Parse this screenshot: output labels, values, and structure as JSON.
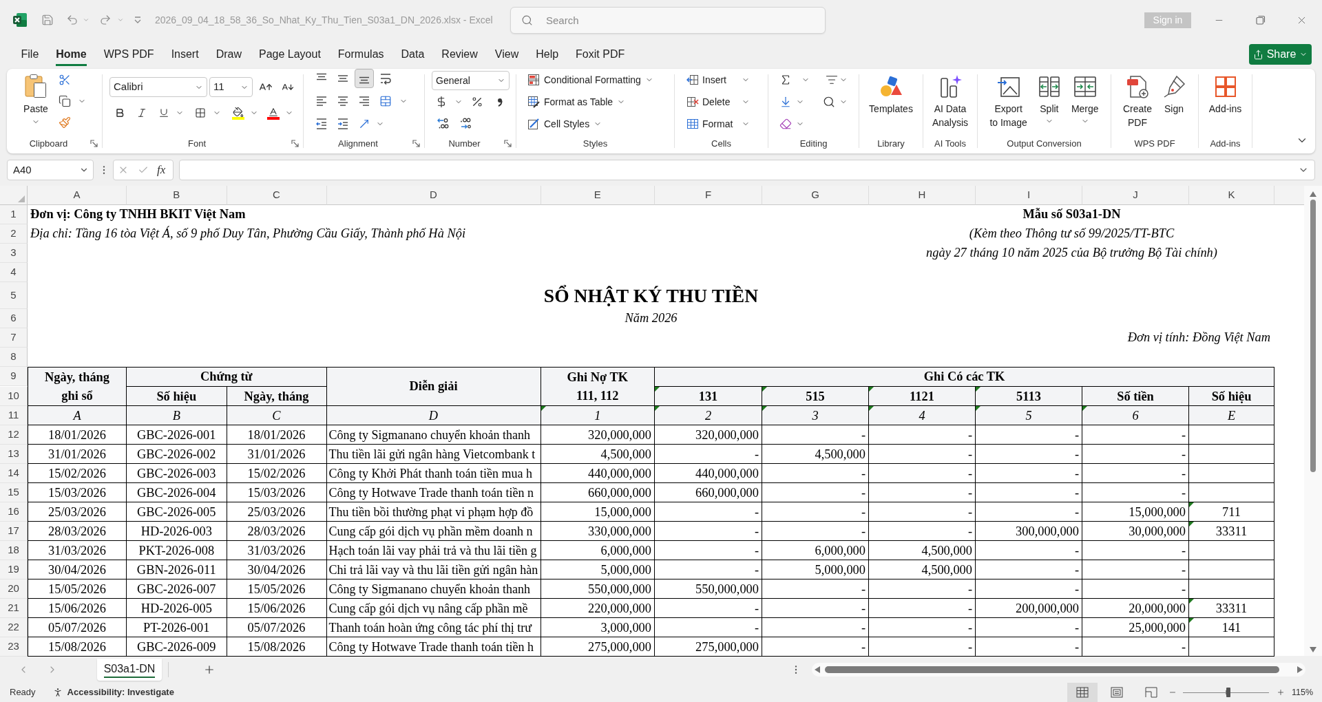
{
  "window": {
    "title": "2026_09_04_18_58_36_So_Nhat_Ky_Thu_Tien_S03a1_DN_2026.xlsx - Excel",
    "search_placeholder": "Search",
    "sign_in": "Sign in"
  },
  "ribbon_tabs": [
    {
      "label": "File",
      "selected": false
    },
    {
      "label": "Home",
      "selected": true
    },
    {
      "label": "WPS PDF",
      "selected": false
    },
    {
      "label": "Insert",
      "selected": false
    },
    {
      "label": "Draw",
      "selected": false
    },
    {
      "label": "Page Layout",
      "selected": false
    },
    {
      "label": "Formulas",
      "selected": false
    },
    {
      "label": "Data",
      "selected": false
    },
    {
      "label": "Review",
      "selected": false
    },
    {
      "label": "View",
      "selected": false
    },
    {
      "label": "Help",
      "selected": false
    },
    {
      "label": "Foxit PDF",
      "selected": false
    }
  ],
  "share_button": "Share",
  "ribbon": {
    "clipboard": {
      "label": "Clipboard",
      "paste": "Paste"
    },
    "font": {
      "label": "Font",
      "font_box": "Calibri",
      "size_box": "11"
    },
    "alignment": {
      "label": "Alignment",
      "vertical": [
        {
          "kind": "top",
          "selected": false
        },
        {
          "kind": "middle",
          "selected": false
        },
        {
          "kind": "bottom",
          "selected": true
        }
      ]
    },
    "number": {
      "label": "Number",
      "format": "General"
    },
    "styles": {
      "label": "Styles",
      "commands": [
        {
          "kind": "conditional_formatting",
          "label": "Conditional Formatting"
        },
        {
          "kind": "format_as_table",
          "label": "Format as Table"
        },
        {
          "kind": "cell_styles",
          "label": "Cell Styles"
        }
      ]
    },
    "cells": {
      "label": "Cells",
      "commands": [
        {
          "kind": "insert",
          "label": "Insert"
        },
        {
          "kind": "delete",
          "label": "Delete"
        },
        {
          "kind": "format",
          "label": "Format"
        }
      ]
    },
    "editing": {
      "label": "Editing"
    },
    "large_groups": [
      {
        "label": "Library",
        "buttons": [
          {
            "kind": "templates",
            "label": "Templates",
            "menu": false
          }
        ]
      },
      {
        "label": "AI Tools",
        "buttons": [
          {
            "kind": "ai_analysis",
            "label": "AI Data\nAnalysis",
            "menu": false
          }
        ]
      },
      {
        "label": "Output Conversion",
        "buttons": [
          {
            "kind": "export_image",
            "label": "Export\nto Image",
            "menu": false
          },
          {
            "kind": "split",
            "label": "Split",
            "menu": true
          },
          {
            "kind": "merge",
            "label": "Merge",
            "menu": true
          }
        ]
      },
      {
        "label": "WPS PDF",
        "buttons": [
          {
            "kind": "create_pdf",
            "label": "Create\nPDF",
            "menu": false
          },
          {
            "kind": "sign",
            "label": "Sign",
            "menu": false
          }
        ]
      },
      {
        "label": "Add-ins",
        "buttons": [
          {
            "kind": "add_ins",
            "label": "Add-ins",
            "menu": false
          }
        ]
      }
    ]
  },
  "formula_bar": {
    "name_box": "A40",
    "function_label": "fx"
  },
  "sheet": {
    "column_headers": [
      "A",
      "B",
      "C",
      "D",
      "E",
      "F",
      "G",
      "H",
      "I",
      "J",
      "K"
    ],
    "rows": [
      {
        "number": "1",
        "kind": "unit_line",
        "left": "Đơn vị: Công ty TNHH BKIT Việt Nam",
        "right": "Mẫu số S03a1-DN"
      },
      {
        "number": "2",
        "kind": "address_line",
        "left": "Địa chỉ: Tầng 16 tòa Việt Á, số 9 phố Duy Tân, Phường Cầu Giấy, Thành phố Hà Nội",
        "right": "(Kèm theo Thông tư số 99/2025/TT-BTC"
      },
      {
        "number": "3",
        "kind": "note_line",
        "right": "ngày 27 tháng 10 năm 2025 của Bộ trưởng Bộ Tài chính)"
      },
      {
        "number": "4",
        "kind": "blank"
      },
      {
        "number": "5",
        "kind": "title",
        "text": "SỔ NHẬT KÝ THU TIỀN"
      },
      {
        "number": "6",
        "kind": "year",
        "text": "Năm 2026"
      },
      {
        "number": "7",
        "kind": "currency_note",
        "text": "Đơn vị tính: Đồng Việt Nam"
      },
      {
        "number": "8",
        "kind": "blank"
      },
      {
        "number": "9",
        "kind": "head_top",
        "cells": [
          "Ngày, tháng\nghi sổ",
          "Chứng từ",
          "Diễn giải",
          "Ghi Nợ TK\n111, 112",
          "Ghi Có các TK"
        ]
      },
      {
        "number": "10",
        "kind": "head_bottom",
        "cells": [
          {
            "text": "Số hiệu",
            "flagged": false
          },
          {
            "text": "Ngày, tháng",
            "flagged": false
          },
          {
            "text": "131",
            "flagged": true
          },
          {
            "text": "515",
            "flagged": true
          },
          {
            "text": "1121",
            "flagged": true
          },
          {
            "text": "5113",
            "flagged": true
          },
          {
            "text": "Số tiền",
            "flagged": false
          },
          {
            "text": "Số hiệu",
            "flagged": false
          }
        ]
      },
      {
        "number": "11",
        "kind": "codes",
        "cells": [
          {
            "text": "A",
            "flagged": false
          },
          {
            "text": "B",
            "flagged": false
          },
          {
            "text": "C",
            "flagged": false
          },
          {
            "text": "D",
            "flagged": false
          },
          {
            "text": "1",
            "flagged": true
          },
          {
            "text": "2",
            "flagged": true
          },
          {
            "text": "3",
            "flagged": true
          },
          {
            "text": "4",
            "flagged": true
          },
          {
            "text": "5",
            "flagged": true
          },
          {
            "text": "6",
            "flagged": true
          },
          {
            "text": "E",
            "flagged": false
          }
        ]
      },
      {
        "number": "12",
        "kind": "entry",
        "cells": [
          "18/01/2026",
          "GBC-2026-001",
          "18/01/2026",
          "Công ty Sigmanano chuyển khoản thanh",
          "320,000,000",
          "320,000,000",
          "-",
          "-",
          "-",
          "-"
        ]
      },
      {
        "number": "13",
        "kind": "entry",
        "cells": [
          "31/01/2026",
          "GBC-2026-002",
          "31/01/2026",
          "Thu tiền lãi gửi ngân hàng Vietcombank t",
          "4,500,000",
          "-",
          "4,500,000",
          "-",
          "-",
          "-"
        ]
      },
      {
        "number": "14",
        "kind": "entry",
        "cells": [
          "15/02/2026",
          "GBC-2026-003",
          "15/02/2026",
          "Công ty Khởi Phát thanh toán tiền mua h",
          "440,000,000",
          "440,000,000",
          "-",
          "-",
          "-",
          "-"
        ]
      },
      {
        "number": "15",
        "kind": "entry",
        "cells": [
          "15/03/2026",
          "GBC-2026-004",
          "15/03/2026",
          "Công ty Hotwave Trade thanh toán tiền n",
          "660,000,000",
          "660,000,000",
          "-",
          "-",
          "-",
          "-"
        ]
      },
      {
        "number": "16",
        "kind": "entry",
        "cells": [
          "25/03/2026",
          "GBC-2026-005",
          "25/03/2026",
          "Thu tiền bồi thường phạt vi phạm hợp đồ",
          "15,000,000",
          "-",
          "-",
          "-",
          "-",
          "15,000,000"
        ],
        "account": {
          "text": "711",
          "flagged": true
        }
      },
      {
        "number": "17",
        "kind": "entry",
        "cells": [
          "28/03/2026",
          "HD-2026-003",
          "28/03/2026",
          "Cung cấp gói dịch vụ phần mềm doanh n",
          "330,000,000",
          "-",
          "-",
          "-",
          "300,000,000",
          "30,000,000"
        ],
        "account": {
          "text": "33311",
          "flagged": true
        }
      },
      {
        "number": "18",
        "kind": "entry",
        "cells": [
          "31/03/2026",
          "PKT-2026-008",
          "31/03/2026",
          "Hạch toán lãi vay phải trả và thu lãi tiền g",
          "6,000,000",
          "-",
          "6,000,000",
          "4,500,000",
          "-",
          "-"
        ]
      },
      {
        "number": "19",
        "kind": "entry",
        "cells": [
          "30/04/2026",
          "GBN-2026-011",
          "30/04/2026",
          "Chi trả lãi vay và thu lãi tiền gửi ngân hàn",
          "5,000,000",
          "-",
          "5,000,000",
          "4,500,000",
          "-",
          "-"
        ]
      },
      {
        "number": "20",
        "kind": "entry",
        "cells": [
          "15/05/2026",
          "GBC-2026-007",
          "15/05/2026",
          "Công ty Sigmanano chuyển khoản thanh",
          "550,000,000",
          "550,000,000",
          "-",
          "-",
          "-",
          "-"
        ]
      },
      {
        "number": "21",
        "kind": "entry",
        "cells": [
          "15/06/2026",
          "HD-2026-005",
          "15/06/2026",
          "Cung cấp gói dịch vụ nâng cấp phần mề",
          "220,000,000",
          "-",
          "-",
          "-",
          "200,000,000",
          "20,000,000"
        ],
        "account": {
          "text": "33311",
          "flagged": true
        }
      },
      {
        "number": "22",
        "kind": "entry",
        "cells": [
          "05/07/2026",
          "PT-2026-001",
          "05/07/2026",
          "Thanh toán hoàn ứng công tác phí thị trư",
          "3,000,000",
          "-",
          "-",
          "-",
          "-",
          "25,000,000"
        ],
        "account": {
          "text": "141",
          "flagged": true
        }
      },
      {
        "number": "23",
        "kind": "entry",
        "cells": [
          "15/08/2026",
          "GBC-2026-009",
          "15/08/2026",
          "Công ty Hotwave Trade thanh toán tiền h",
          "275,000,000",
          "275,000,000",
          "-",
          "-",
          "-",
          "-"
        ]
      }
    ]
  },
  "sheet_tabs": [
    {
      "label": "S03a1-DN",
      "selected": true
    }
  ],
  "status_bar": {
    "status": "Ready",
    "accessibility": "Accessibility: Investigate",
    "views": [
      {
        "kind": "normal",
        "selected": true
      },
      {
        "kind": "page_layout",
        "selected": false
      },
      {
        "kind": "page_break",
        "selected": false
      }
    ],
    "zoom": {
      "level": 0.53,
      "label": "115%"
    }
  }
}
